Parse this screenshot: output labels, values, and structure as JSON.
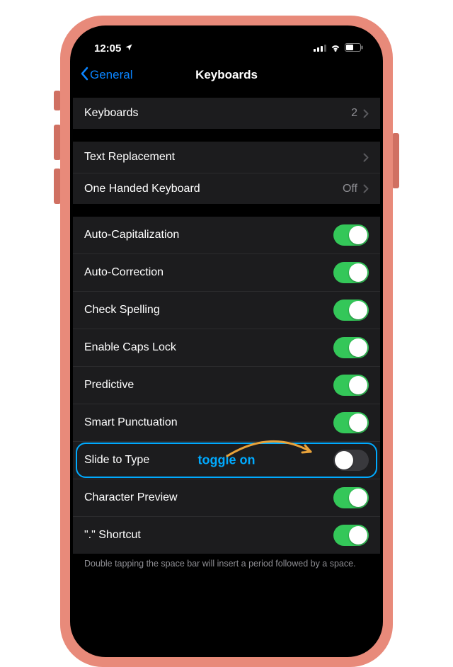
{
  "status": {
    "time": "12:05",
    "location_icon": "location-arrow-icon",
    "signal_icon": "cell-signal-icon",
    "wifi_icon": "wifi-icon",
    "battery_icon": "battery-icon"
  },
  "nav": {
    "back_label": "General",
    "title": "Keyboards"
  },
  "section1": [
    {
      "label": "Keyboards",
      "value": "2",
      "chevron": true
    }
  ],
  "section2": [
    {
      "label": "Text Replacement",
      "value": "",
      "chevron": true
    },
    {
      "label": "One Handed Keyboard",
      "value": "Off",
      "chevron": true
    }
  ],
  "section3": [
    {
      "label": "Auto-Capitalization",
      "toggle": true
    },
    {
      "label": "Auto-Correction",
      "toggle": true
    },
    {
      "label": "Check Spelling",
      "toggle": true
    },
    {
      "label": "Enable Caps Lock",
      "toggle": true
    },
    {
      "label": "Predictive",
      "toggle": true
    },
    {
      "label": "Smart Punctuation",
      "toggle": true
    },
    {
      "label": "Slide to Type",
      "toggle": false,
      "highlight": true
    },
    {
      "label": "Character Preview",
      "toggle": true
    },
    {
      "label": "\".\" Shortcut",
      "toggle": true
    }
  ],
  "footer": "Double tapping the space bar will insert a period followed by a space.",
  "annotation": {
    "text": "toggle on"
  },
  "colors": {
    "accent": "#0a84ff",
    "toggle_on": "#34c759",
    "highlight": "#00aaff",
    "arrow": "#e8a23a"
  }
}
